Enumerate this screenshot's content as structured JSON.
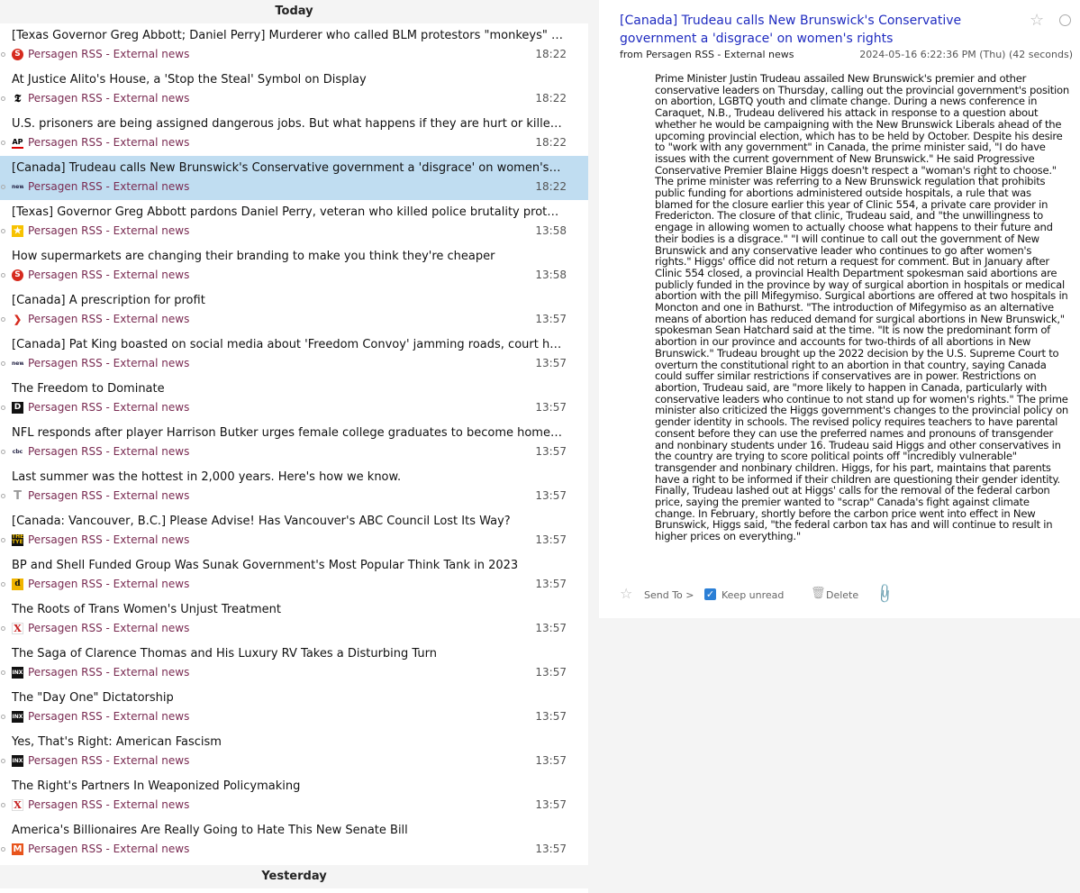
{
  "list": {
    "group_today": "Today",
    "group_yesterday": "Yesterday",
    "messages": [
      {
        "title": "[Texas Governor Greg Abbott; Daniel Perry] Murderer who called BLM protestors \"monkeys\" pardoned by Texas Governor Greg Abbott",
        "source": "Persagen RSS - External news",
        "time": "18:22",
        "icon": "red-circle-s-icon"
      },
      {
        "title": "At Justice Alito's House, a 'Stop the Steal' Symbol on Display",
        "source": "Persagen RSS - External news",
        "time": "18:22",
        "icon": "nyt-icon"
      },
      {
        "title": "U.S. prisoners are being assigned dangerous jobs. But what happens if they are hurt or killed?",
        "source": "Persagen RSS - External news",
        "time": "18:22",
        "icon": "ap-icon"
      },
      {
        "title": "[Canada] Trudeau calls New Brunswick's Conservative government a 'disgrace' on women's rights",
        "source": "Persagen RSS - External news",
        "time": "18:22",
        "icon": "news-icon"
      },
      {
        "title": "[Texas] Governor Greg Abbott pardons Daniel Perry, veteran who killed police brutality protester",
        "source": "Persagen RSS - External news",
        "time": "13:58",
        "icon": "star-badge-icon"
      },
      {
        "title": "How supermarkets are changing their branding to make you think they're cheaper",
        "source": "Persagen RSS - External news",
        "time": "13:58",
        "icon": "red-circle-s-icon"
      },
      {
        "title": "[Canada] A prescription for profit",
        "source": "Persagen RSS - External news",
        "time": "13:57",
        "icon": "red-chevron-icon"
      },
      {
        "title": "[Canada] Pat King boasted on social media about 'Freedom Convoy' jamming roads, court hears",
        "source": "Persagen RSS - External news",
        "time": "13:57",
        "icon": "news-icon"
      },
      {
        "title": "The Freedom to Dominate",
        "source": "Persagen RSS - External news",
        "time": "13:57",
        "icon": "d-logo-icon"
      },
      {
        "title": "NFL responds after player Harrison Butker urges female college graduates to become homemakers",
        "source": "Persagen RSS - External news",
        "time": "13:57",
        "icon": "cbc-icon"
      },
      {
        "title": "Last summer was the hottest in 2,000 years. Here's how we know.",
        "source": "Persagen RSS - External news",
        "time": "13:57",
        "icon": "t-logo-icon"
      },
      {
        "title": "[Canada: Vancouver, B.C.] Please Advise! Has Vancouver's ABC Council Lost Its Way?",
        "source": "Persagen RSS - External news",
        "time": "13:57",
        "icon": "tyee-icon"
      },
      {
        "title": "BP and Shell Funded Group Was Sunak Government's Most Popular Think Tank in 2023",
        "source": "Persagen RSS - External news",
        "time": "13:57",
        "icon": "desmog-icon"
      },
      {
        "title": "The Roots of Trans Women's Unjust Treatment",
        "source": "Persagen RSS - External news",
        "time": "13:57",
        "icon": "x-logo-icon"
      },
      {
        "title": "The Saga of Clarence Thomas and His Luxury RV Takes a Disturbing Turn",
        "source": "Persagen RSS - External news",
        "time": "13:57",
        "icon": "inx-icon"
      },
      {
        "title": "The \"Day One\" Dictatorship",
        "source": "Persagen RSS - External news",
        "time": "13:57",
        "icon": "inx-icon"
      },
      {
        "title": "Yes, That's Right: American Fascism",
        "source": "Persagen RSS - External news",
        "time": "13:57",
        "icon": "inx-icon"
      },
      {
        "title": "The Right's Partners In Weaponized Policymaking",
        "source": "Persagen RSS - External news",
        "time": "13:57",
        "icon": "x-logo-icon"
      },
      {
        "title": "America's Billionaires Are Really Going to Hate This New Senate Bill",
        "source": "Persagen RSS - External news",
        "time": "13:57",
        "icon": "m-logo-icon"
      }
    ]
  },
  "reader": {
    "title": "[Canada] Trudeau calls New Brunswick's Conservative government a 'disgrace' on women's rights",
    "from": "from Persagen RSS - External news",
    "date": "2024-05-16 6:22:36 PM (Thu) (42 seconds)",
    "body": "Prime Minister Justin Trudeau assailed New Brunswick's premier and other conservative leaders on Thursday, calling out the provincial government's position on abortion, LGBTQ youth and climate change. During a news conference in Caraquet, N.B., Trudeau delivered his attack in response to a question about whether he would be campaigning with the New Brunswick Liberals ahead of the upcoming provincial election, which has to be held by October. Despite his desire to \"work with any government\" in Canada, the prime minister said, \"I do have issues with the current government of New Brunswick.\" He said Progressive Conservative Premier Blaine Higgs doesn't respect a \"woman's right to choose.\" The prime minister was referring to a New Brunswick regulation that prohibits public funding for abortions administered outside hospitals, a rule that was blamed for the closure earlier this year of Clinic 554, a private care provider in Fredericton. The closure of that clinic, Trudeau said, and \"the unwillingness to engage in allowing women to actually choose what happens to their future and their bodies is a disgrace.\" \"I will continue to call out the government of New Brunswick and any conservative leader who continues to go after women's rights.\" Higgs' office did not return a request for comment. But in January after Clinic 554 closed, a provincial Health Department spokesman said abortions are publicly funded in the province by way of surgical abortion in hospitals or medical abortion with the pill Mifegymiso. Surgical abortions are offered at two hospitals in Moncton and one in Bathurst. \"The introduction of Mifegymiso as an alternative means of abortion has reduced demand for surgical abortions in New Brunswick,\" spokesman Sean Hatchard said at the time. \"It is now the predominant form of abortion in our province and accounts for two-thirds of all abortions in New Brunswick.\" Trudeau brought up the 2022 decision by the U.S. Supreme Court to overturn the constitutional right to an abortion in that country, saying Canada could suffer similar restrictions if conservatives are in power. Restrictions on abortion, Trudeau said, are \"more likely to happen in Canada, particularly with conservative leaders who continue to not stand up for women's rights.\" The prime minister also criticized the Higgs government's changes to the provincial policy on gender identity in schools. The revised policy requires teachers to have parental consent before they can use the preferred names and pronouns of transgender and nonbinary students under 16. Trudeau said Higgs and other conservatives in the country are trying to score political points off \"incredibly vulnerable\" transgender and nonbinary children. Higgs, for his part, maintains that parents have a right to be informed if their children are questioning their gender identity. Finally, Trudeau lashed out at Higgs' calls for the removal of the federal carbon price, saying the premier wanted to \"scrap\" Canada's fight against climate change. In February, shortly before the carbon price went into effect in New Brunswick, Higgs said, \"the federal carbon tax has and will continue to result in higher prices on everything.\"",
    "actions": {
      "send_to": "Send To >",
      "keep_unread": "Keep unread",
      "delete": "Delete"
    }
  },
  "colors": {
    "selected_row": "#c0ddf1",
    "title_link": "#1f2bc0",
    "source_text": "#7a2b52",
    "checkbox": "#2b7fd6"
  }
}
